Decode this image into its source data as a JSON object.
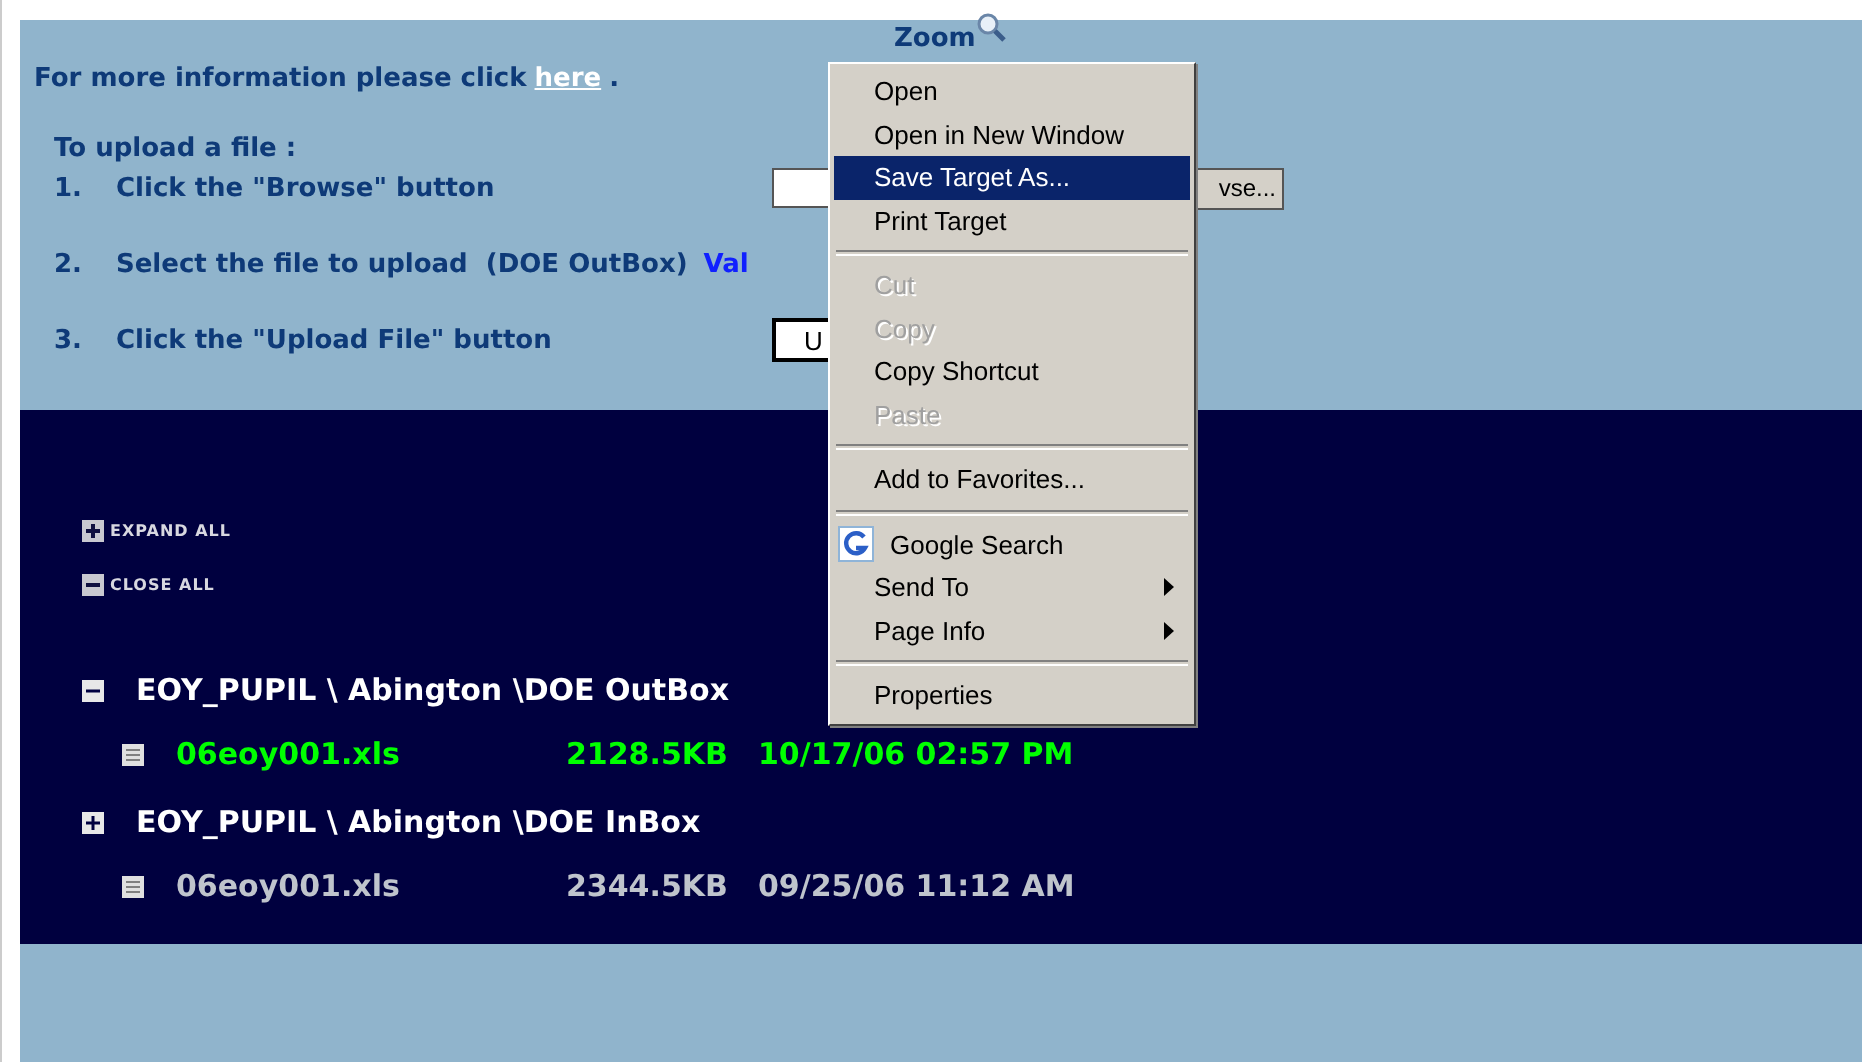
{
  "zoom_link": "Zoom",
  "info": {
    "text": "For more information please click",
    "link": "here",
    "end": "."
  },
  "upload": {
    "heading": "To upload a file :",
    "steps": [
      {
        "number": "1.",
        "text": "Click the \"Browse\" button",
        "kind": "browse",
        "control": "vse..."
      },
      {
        "number": "2.",
        "text": "Select the file to upload  (DOE OutBox)",
        "kind": "note",
        "control": "Val"
      },
      {
        "number": "3.",
        "text": "Click the \"Upload File\" button",
        "kind": "upload",
        "control": "U"
      }
    ]
  },
  "tree_controls": [
    {
      "label": "EXPAND ALL",
      "kind": "expand"
    },
    {
      "label": "CLOSE ALL",
      "kind": "collapse"
    }
  ],
  "folders": [
    {
      "path": "EOY_PUPIL \\ Abington \\DOE OutBox",
      "expanded": true,
      "children": [
        {
          "name": "06eoy001.xls",
          "size": "2128.5KB",
          "date": "10/17/06 02:57 PM",
          "highlighted": true
        }
      ]
    },
    {
      "path": "EOY_PUPIL \\ Abington \\DOE InBox",
      "expanded": false,
      "children": [
        {
          "name": "06eoy001.xls",
          "size": "2344.5KB",
          "date": "09/25/06 11:12 AM",
          "highlighted": false
        }
      ]
    }
  ],
  "context_menu": [
    {
      "kind": "item",
      "label": "Open",
      "disabled": false,
      "selected": false
    },
    {
      "kind": "item",
      "label": "Open in New Window",
      "disabled": false,
      "selected": false
    },
    {
      "kind": "item",
      "label": "Save Target As...",
      "disabled": false,
      "selected": true
    },
    {
      "kind": "item",
      "label": "Print Target",
      "disabled": false,
      "selected": false
    },
    {
      "kind": "separator"
    },
    {
      "kind": "item",
      "label": "Cut",
      "disabled": true,
      "selected": false
    },
    {
      "kind": "item",
      "label": "Copy",
      "disabled": true,
      "selected": false
    },
    {
      "kind": "item",
      "label": "Copy Shortcut",
      "disabled": false,
      "selected": false
    },
    {
      "kind": "item",
      "label": "Paste",
      "disabled": true,
      "selected": false
    },
    {
      "kind": "separator"
    },
    {
      "kind": "item",
      "label": "Add to Favorites...",
      "disabled": false,
      "selected": false
    },
    {
      "kind": "separator"
    },
    {
      "kind": "search",
      "label": "Google Search",
      "disabled": false,
      "selected": false
    },
    {
      "kind": "submenu",
      "label": "Send To",
      "disabled": false,
      "selected": false
    },
    {
      "kind": "submenu",
      "label": "Page Info",
      "disabled": false,
      "selected": false
    },
    {
      "kind": "separator"
    },
    {
      "kind": "item",
      "label": "Properties",
      "disabled": false,
      "selected": false
    }
  ]
}
